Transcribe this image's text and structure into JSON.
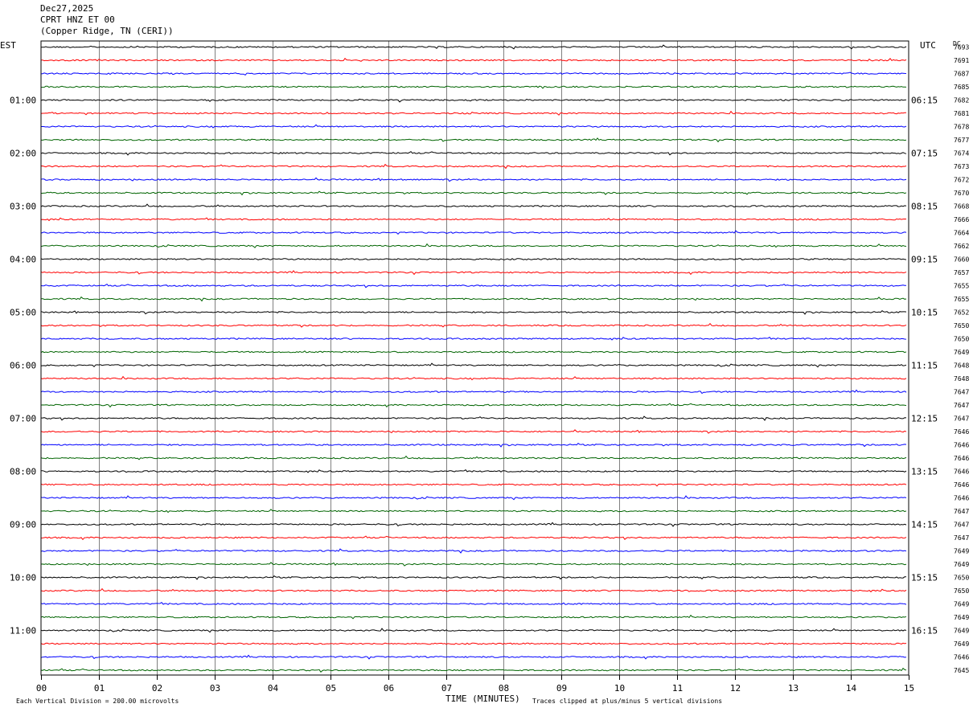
{
  "header": {
    "date": "Dec27,2025",
    "station": "CPRT HNZ ET 00",
    "location": "(Copper Ridge, TN (CERI))"
  },
  "labels": {
    "left_tz": "EST",
    "right_tz": "UTC",
    "dc": "DC",
    "xlabel": "TIME (MINUTES)",
    "scale_note": "Each Vertical Division =  200.00 microvolts",
    "clip_note": "Traces clipped at plus/minus 5 vertical divisions"
  },
  "colors": {
    "trace_cycle": [
      "#000000",
      "#ff0000",
      "#0000ff",
      "#006400"
    ],
    "grid": "#808080"
  },
  "chart_data": {
    "type": "line",
    "x_ticks": [
      "00",
      "01",
      "02",
      "03",
      "04",
      "05",
      "06",
      "07",
      "08",
      "09",
      "10",
      "11",
      "12",
      "13",
      "14",
      "15"
    ],
    "xlim": [
      0,
      15
    ],
    "left_hour_labels": [
      "01:00",
      "02:00",
      "03:00",
      "04:00",
      "05:00",
      "06:00",
      "07:00",
      "08:00",
      "09:00",
      "10:00",
      "11:00"
    ],
    "right_hour_labels": [
      "06:15",
      "07:15",
      "08:15",
      "09:15",
      "10:15",
      "11:15",
      "12:15",
      "13:15",
      "14:15",
      "15:15",
      "16:15"
    ],
    "dc_offsets": [
      "7693",
      "7691",
      "7687",
      "7685",
      "7682",
      "7681",
      "7678",
      "7677",
      "7674",
      "7673",
      "7672",
      "7670",
      "7668",
      "7666",
      "7664",
      "7662",
      "7660",
      "7657",
      "7655",
      "7655",
      "7652",
      "7650",
      "7650",
      "7649",
      "7648",
      "7648",
      "7647",
      "7647",
      "7647",
      "7646",
      "7646",
      "7646",
      "7646",
      "7646",
      "7646",
      "7647",
      "7647",
      "7647",
      "7649",
      "7649",
      "7650",
      "7650",
      "7649",
      "7649",
      "7649",
      "7649",
      "7646",
      "7645"
    ]
  }
}
